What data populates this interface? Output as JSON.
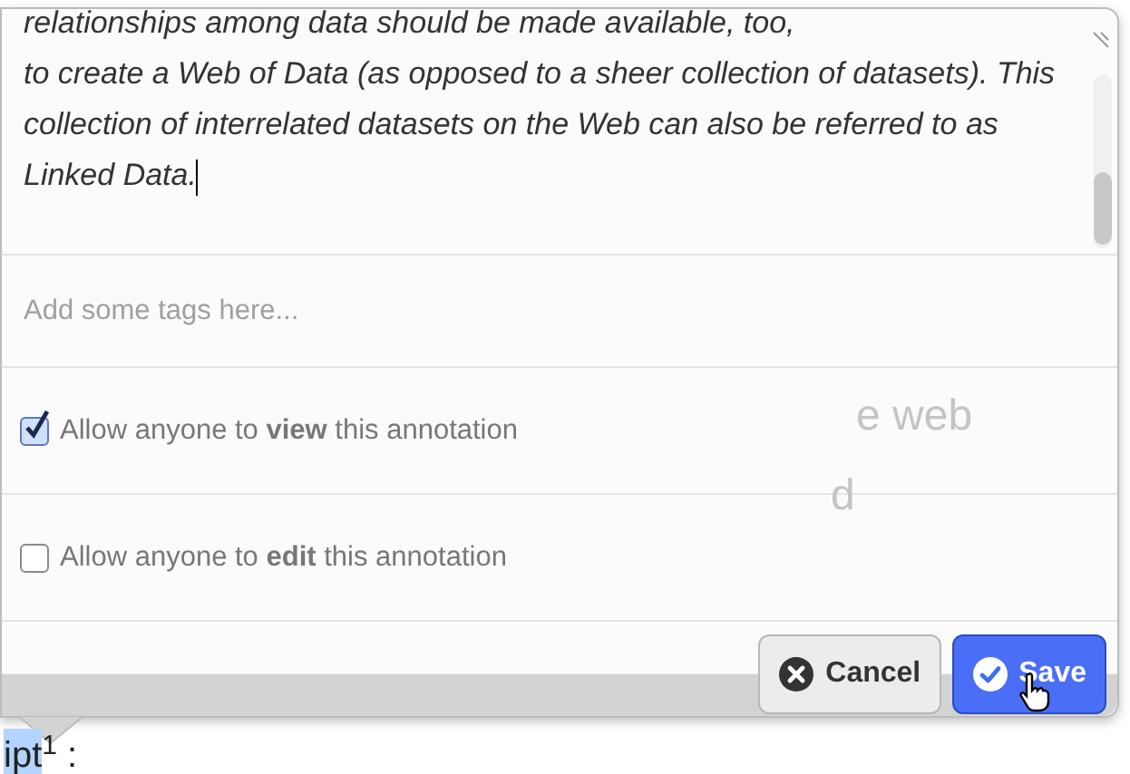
{
  "editor": {
    "text": "relationships among data should be made available, too,\nto create a Web of Data (as opposed to a sheer collection of datasets). This collection of interrelated datasets on the Web can also be referred to as Linked Data.",
    "tags": {
      "placeholder": "Add some tags here..."
    },
    "permissions": [
      {
        "label": "Allow anyone to **view** this annotation",
        "checked": true
      },
      {
        "label": "Allow anyone to **edit** this annotation",
        "checked": false
      }
    ],
    "buttons": [
      {
        "label": "Cancel",
        "kind": "cancel"
      },
      {
        "label": "Save",
        "kind": "save"
      }
    ]
  },
  "page_behind": {
    "fragments": [
      "e web",
      "d"
    ],
    "highlighted": "ipt",
    "after": "$^{1}$ :"
  }
}
